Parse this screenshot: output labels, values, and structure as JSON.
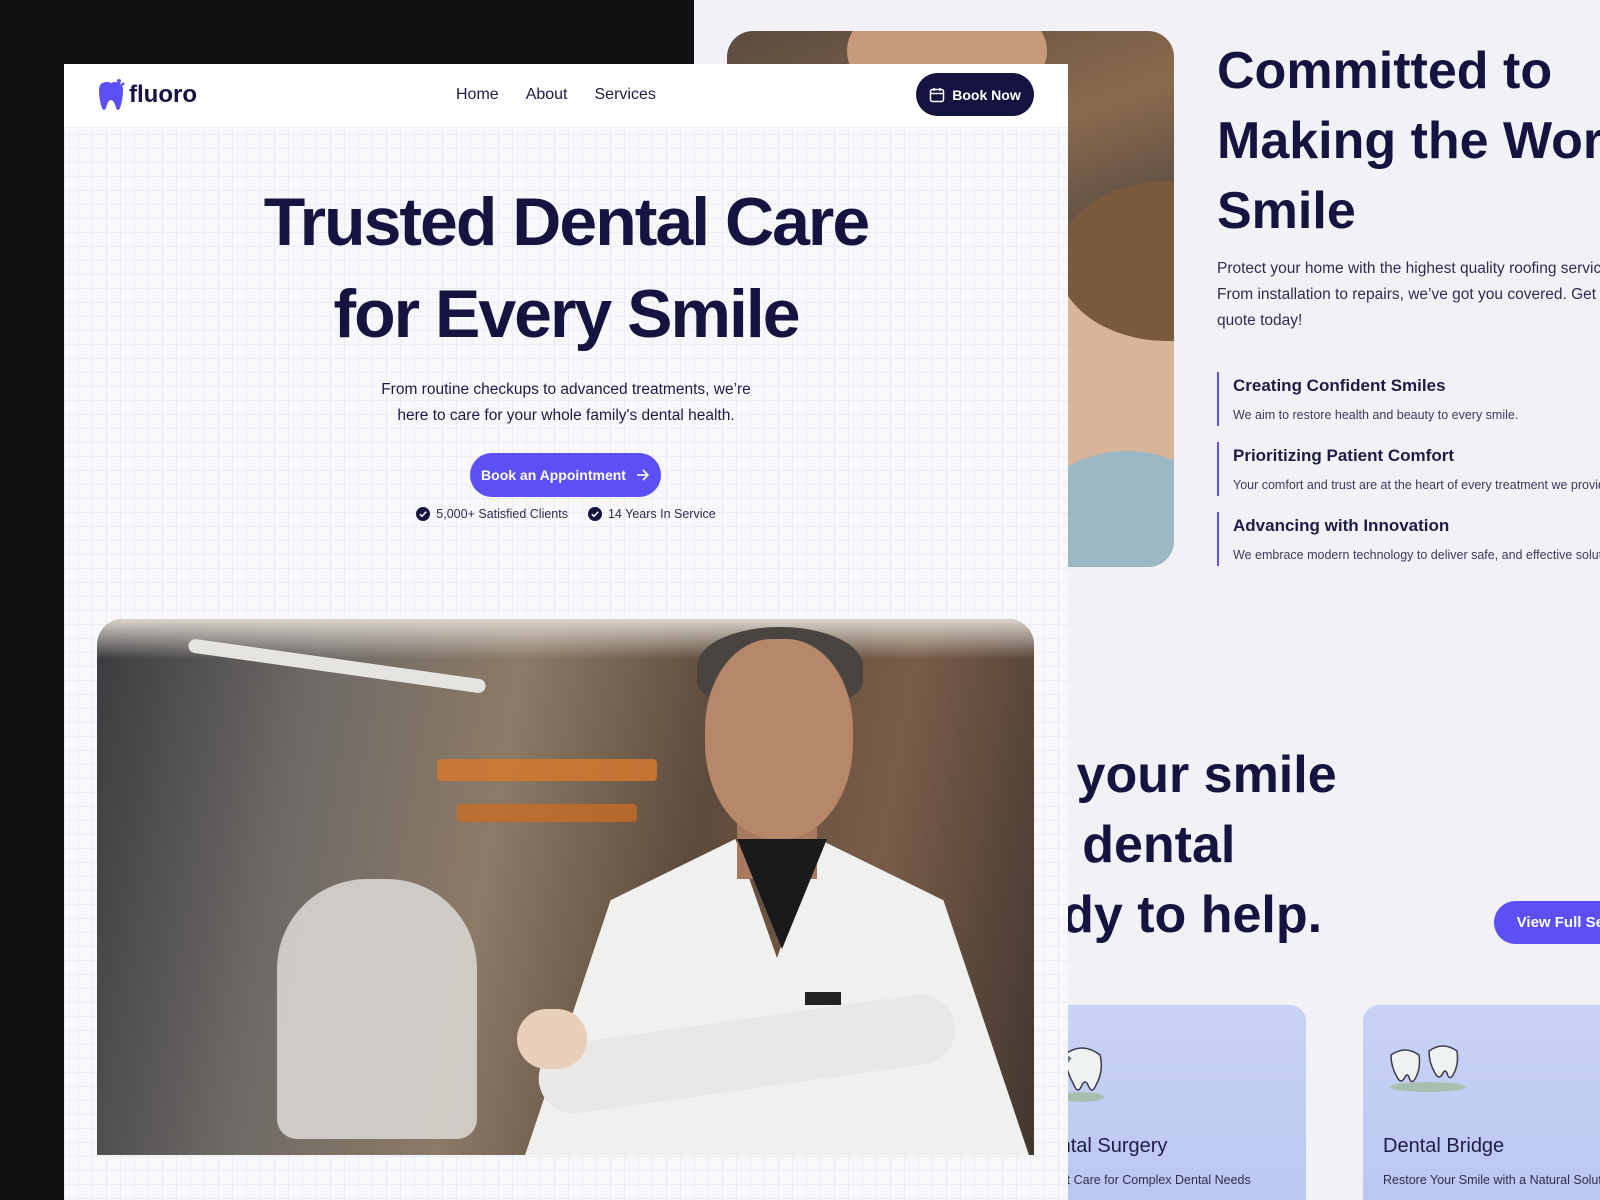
{
  "nav": {
    "logo_text": "fluoro",
    "links": [
      "Home",
      "About",
      "Services"
    ],
    "cta_label": "Book Now"
  },
  "hero": {
    "title_line1": "Trusted Dental Care",
    "title_line2": "for Every Smile",
    "subtitle_line1": "From routine checkups to advanced treatments, we’re",
    "subtitle_line2": "here to care for your whole family's dental health.",
    "cta_label": "Book an Appointment",
    "stats": [
      "5,000+ Satisfied Clients",
      "14 Years In Service"
    ]
  },
  "about": {
    "headline_line1": "Committed to",
    "headline_line2": "Making the World",
    "headline_line3": "Smile",
    "desc_line1": "Protect your home with the highest quality roofing services.",
    "desc_line2": "From installation to repairs, we’ve got you covered. Get a",
    "desc_line3": "quote today!",
    "values": [
      {
        "title": "Creating Confident Smiles",
        "desc": "We aim to restore health and beauty to every smile."
      },
      {
        "title": "Prioritizing Patient Comfort",
        "desc": "Your comfort and trust are at the heart of every treatment we provide."
      },
      {
        "title": "Advancing with Innovation",
        "desc": "We embrace modern technology to deliver safe, and effective solutions."
      }
    ]
  },
  "services": {
    "heading_line1": "ver your smile",
    "heading_line2": "our dental",
    "heading_line3": "ready to help.",
    "cta_label": "View Full Services",
    "cards": [
      {
        "title": "Dental Surgery",
        "desc": "Expert Care for Complex Dental Needs"
      },
      {
        "title": "Dental Bridge",
        "desc": "Restore Your Smile with a Natural Solution"
      }
    ]
  },
  "colors": {
    "navy": "#15133f",
    "accent": "#5b4ff5",
    "card": "#c9d3f5"
  }
}
